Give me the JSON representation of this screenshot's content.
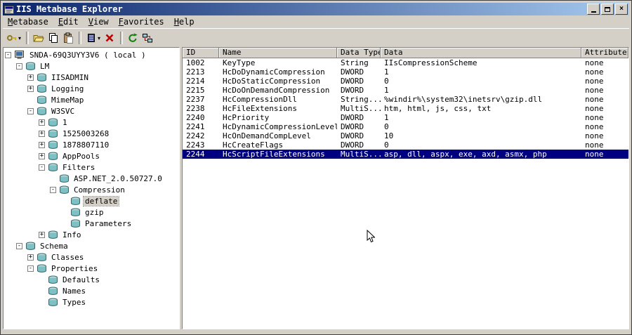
{
  "window": {
    "title": "IIS Metabase Explorer"
  },
  "titlebar": {
    "buttons": [
      {
        "name": "minimize-button",
        "icon": "minimize-icon"
      },
      {
        "name": "maximize-button",
        "icon": "maximize-icon"
      },
      {
        "name": "close-button",
        "icon": "close-icon",
        "glyph": "x"
      }
    ]
  },
  "menu": {
    "items": [
      {
        "label": "Metabase"
      },
      {
        "label": "Edit"
      },
      {
        "label": "View"
      },
      {
        "label": "Favorites"
      },
      {
        "label": "Help"
      }
    ]
  },
  "toolbar": {
    "items": [
      {
        "type": "button",
        "name": "new-key-button",
        "icon": "key-icon",
        "dropdown": true
      },
      {
        "type": "separator"
      },
      {
        "type": "button",
        "name": "open-button",
        "icon": "folder-open-icon"
      },
      {
        "type": "button",
        "name": "copy-button",
        "icon": "copy-icon"
      },
      {
        "type": "button",
        "name": "paste-button",
        "icon": "paste-icon"
      },
      {
        "type": "separator"
      },
      {
        "type": "button",
        "name": "new-data-button",
        "icon": "new-data-icon",
        "dropdown": true
      },
      {
        "type": "button",
        "name": "delete-button",
        "icon": "delete-icon"
      },
      {
        "type": "separator"
      },
      {
        "type": "button",
        "name": "refresh-button",
        "icon": "refresh-icon"
      },
      {
        "type": "button",
        "name": "connect-button",
        "icon": "network-icon"
      }
    ]
  },
  "tree": {
    "items": [
      {
        "depth": 0,
        "label": "SNDA-69Q3UYY3V6 ( local )",
        "expander": "minus",
        "icon": "computer"
      },
      {
        "depth": 1,
        "label": "LM",
        "expander": "minus",
        "icon": "node"
      },
      {
        "depth": 2,
        "label": "IISADMIN",
        "expander": "plus",
        "icon": "node"
      },
      {
        "depth": 2,
        "label": "Logging",
        "expander": "plus",
        "icon": "node"
      },
      {
        "depth": 2,
        "label": "MimeMap",
        "expander": null,
        "icon": "node"
      },
      {
        "depth": 2,
        "label": "W3SVC",
        "expander": "minus",
        "icon": "node"
      },
      {
        "depth": 3,
        "label": "1",
        "expander": "plus",
        "icon": "node"
      },
      {
        "depth": 3,
        "label": "1525003268",
        "expander": "plus",
        "icon": "node"
      },
      {
        "depth": 3,
        "label": "1878807110",
        "expander": "plus",
        "icon": "node"
      },
      {
        "depth": 3,
        "label": "AppPools",
        "expander": "plus",
        "icon": "node"
      },
      {
        "depth": 3,
        "label": "Filters",
        "expander": "minus",
        "icon": "node"
      },
      {
        "depth": 4,
        "label": "ASP.NET_2.0.50727.0",
        "expander": null,
        "icon": "node"
      },
      {
        "depth": 4,
        "label": "Compression",
        "expander": "minus",
        "icon": "node"
      },
      {
        "depth": 5,
        "label": "deflate",
        "expander": null,
        "icon": "node",
        "selected": true
      },
      {
        "depth": 5,
        "label": "gzip",
        "expander": null,
        "icon": "node"
      },
      {
        "depth": 5,
        "label": "Parameters",
        "expander": null,
        "icon": "node"
      },
      {
        "depth": 3,
        "label": "Info",
        "expander": "plus",
        "icon": "node"
      },
      {
        "depth": 1,
        "label": "Schema",
        "expander": "minus",
        "icon": "node"
      },
      {
        "depth": 2,
        "label": "Classes",
        "expander": "plus",
        "icon": "node"
      },
      {
        "depth": 2,
        "label": "Properties",
        "expander": "minus",
        "icon": "node"
      },
      {
        "depth": 3,
        "label": "Defaults",
        "expander": null,
        "icon": "node"
      },
      {
        "depth": 3,
        "label": "Names",
        "expander": null,
        "icon": "node"
      },
      {
        "depth": 3,
        "label": "Types",
        "expander": null,
        "icon": "node"
      }
    ]
  },
  "list": {
    "columns": [
      "ID",
      "Name",
      "Data Type",
      "Data",
      "Attributes"
    ],
    "rows": [
      {
        "id": "1002",
        "name": "KeyType",
        "type": "String",
        "value": "IIsCompressionScheme",
        "attributes": "none"
      },
      {
        "id": "2213",
        "name": "HcDoDynamicCompression",
        "type": "DWORD",
        "value": "1",
        "attributes": "none"
      },
      {
        "id": "2214",
        "name": "HcDoStaticCompression",
        "type": "DWORD",
        "value": "0",
        "attributes": "none"
      },
      {
        "id": "2215",
        "name": "HcDoOnDemandCompression",
        "type": "DWORD",
        "value": "1",
        "attributes": "none"
      },
      {
        "id": "2237",
        "name": "HcCompressionDll",
        "type": "String...",
        "value": "%windir%\\system32\\inetsrv\\gzip.dll",
        "attributes": "none"
      },
      {
        "id": "2238",
        "name": "HcFileExtensions",
        "type": "MultiS...",
        "value": "htm, html, js, css, txt",
        "attributes": "none"
      },
      {
        "id": "2240",
        "name": "HcPriority",
        "type": "DWORD",
        "value": "1",
        "attributes": "none"
      },
      {
        "id": "2241",
        "name": "HcDynamicCompressionLevel",
        "type": "DWORD",
        "value": "0",
        "attributes": "none"
      },
      {
        "id": "2242",
        "name": "HcOnDemandCompLevel",
        "type": "DWORD",
        "value": "10",
        "attributes": "none"
      },
      {
        "id": "2243",
        "name": "HcCreateFlags",
        "type": "DWORD",
        "value": "0",
        "attributes": "none"
      },
      {
        "id": "2244",
        "name": "HcScriptFileExtensions",
        "type": "MultiS...",
        "value": "asp, dll, aspx, exe, axd, asmx, php",
        "attributes": "none",
        "selected": true
      }
    ]
  },
  "colors": {
    "selection": "#000080",
    "titlebar_left": "#0a246a",
    "titlebar_right": "#a6caf0",
    "chrome": "#d4d0c8"
  }
}
